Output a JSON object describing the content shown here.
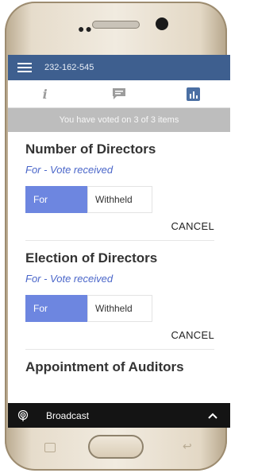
{
  "header": {
    "meeting_id": "232-162-545"
  },
  "tabs": [
    {
      "name": "info",
      "icon": "info-icon"
    },
    {
      "name": "messages",
      "icon": "chat-icon"
    },
    {
      "name": "voting",
      "icon": "bar-chart-icon",
      "active": true
    }
  ],
  "status": {
    "text": "You have voted on 3 of 3 items"
  },
  "items": [
    {
      "title": "Number of Directors",
      "status": "For - Vote received",
      "for_label": "For",
      "withheld_label": "Withheld",
      "cancel_label": "CANCEL"
    },
    {
      "title": "Election of Directors",
      "status": "For - Vote received",
      "for_label": "For",
      "withheld_label": "Withheld",
      "cancel_label": "CANCEL"
    },
    {
      "title": "Appointment of Auditors"
    }
  ],
  "bottom_bar": {
    "label": "Broadcast",
    "icon": "broadcast-icon",
    "toggle_icon": "chevron-up-icon"
  },
  "colors": {
    "app_bar": "#3e5f8f",
    "accent": "#4b6fa3",
    "vote_for": "#6d86e0",
    "vote_status": "#4a66c9",
    "status_banner": "#bdbdbd",
    "bottom_bar": "#141414"
  }
}
